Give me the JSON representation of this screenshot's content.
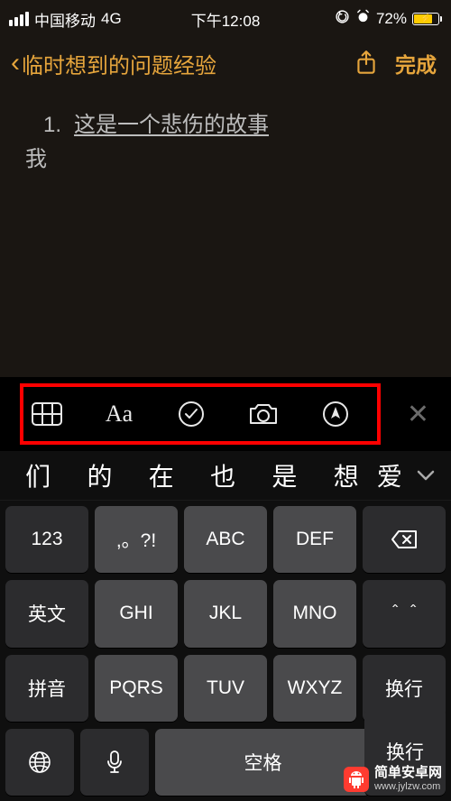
{
  "status": {
    "carrier": "中国移动",
    "network": "4G",
    "time": "下午12:08",
    "battery_percent": "72%"
  },
  "nav": {
    "back_title": "临时想到的问题经验",
    "done": "完成"
  },
  "note": {
    "list_number": "1.",
    "line1": "这是一个悲伤的故事",
    "line2": "我"
  },
  "toolbar": {
    "items": [
      "table-icon",
      "text-format-icon",
      "checklist-icon",
      "camera-icon",
      "markup-icon"
    ]
  },
  "keyboard": {
    "candidates": [
      "们",
      "的",
      "在",
      "也",
      "是",
      "想",
      "爱"
    ],
    "rows": [
      {
        "keys": [
          "123",
          ",。?!",
          "ABC",
          "DEF"
        ],
        "trailing": "backspace"
      },
      {
        "keys": [
          "英文",
          "GHI",
          "JKL",
          "MNO"
        ],
        "trailing": "caret"
      },
      {
        "keys": [
          "拼音",
          "PQRS",
          "TUV",
          "WXYZ"
        ],
        "trailing_span": true
      },
      {
        "enter": "换行",
        "globe": true,
        "mic": true,
        "space": "空格"
      }
    ],
    "mode_keys": {
      "num": "123",
      "eng": "英文",
      "pinyin": "拼音"
    },
    "space": "空格",
    "enter": "换行"
  },
  "watermark": {
    "line1": "简单安卓网",
    "line2": "www.jylzw.com"
  }
}
